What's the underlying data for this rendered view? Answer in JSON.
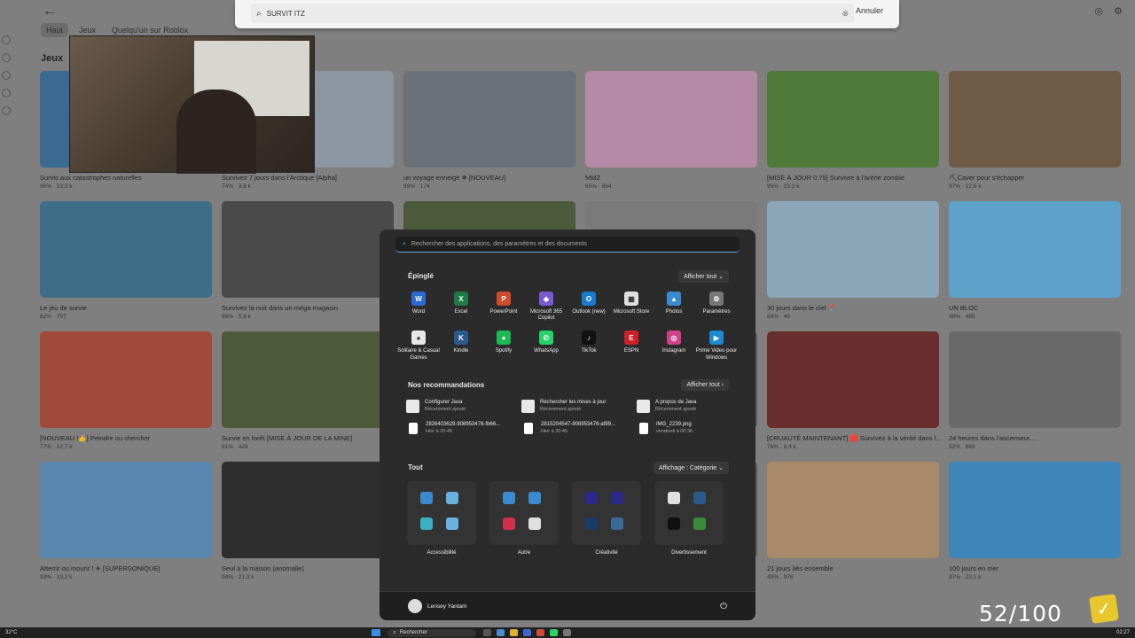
{
  "search": {
    "query": "SURVIT ITZ",
    "cancel_label": "Annuler"
  },
  "nav": {
    "tabs": [
      "Haut",
      "Jeux",
      "Quelqu'un sur Roblox"
    ],
    "section_title": "Jeux"
  },
  "games": [
    {
      "title": "Survis aux catastrophes naturelles",
      "stats": "90% · 13,3 k",
      "color": "#3a6a92"
    },
    {
      "title": "Survivez 7 jours dans l'Arctique [Alpha]",
      "stats": "74% · 3,8 k",
      "color": "#8c97a3"
    },
    {
      "title": "un voyage enneigé ❄ [NOUVEAU]",
      "stats": "89% · 174",
      "color": "#6a7278"
    },
    {
      "title": "MMZ",
      "stats": "65% · 864",
      "color": "#b58aa6"
    },
    {
      "title": "[MISE À JOUR 0.75] Survivre à l'arène zombie",
      "stats": "95% · 23,2 k",
      "color": "#4f7a3a"
    },
    {
      "title": "⛏Caver pour s'échapper",
      "stats": "97% · 12,6 k",
      "color": "#6e5a45"
    },
    {
      "title": "Le jeu de survie",
      "stats": "82% · 757",
      "color": "#3f6f88"
    },
    {
      "title": "Survivez la nuit dans un méga magasin",
      "stats": "95% · 5,8 k",
      "color": "#4a4a4a"
    },
    {
      "title": "",
      "stats": "",
      "color": "#4a5a3a"
    },
    {
      "title": "",
      "stats": "",
      "color": "#7a7a7a"
    },
    {
      "title": "30 jours dans le ciel 📍",
      "stats": "89% · 49",
      "color": "#8aa6b8"
    },
    {
      "title": "UN BLOC",
      "stats": "90% · 485",
      "color": "#5fa2c9"
    },
    {
      "title": "[NOUVEAU !👍] Peindre ou chercher",
      "stats": "77% · 12,7 k",
      "color": "#a24a3a"
    },
    {
      "title": "Survie en forêt [MISE À JOUR DE LA MINE]",
      "stats": "81% · 428",
      "color": "#4f5a3a"
    },
    {
      "title": "",
      "stats": "",
      "color": "#5a5a5a"
    },
    {
      "title": "",
      "stats": "",
      "color": "#5a5a5a"
    },
    {
      "title": "[CRUAUTÉ MAINTENANT] 🟥 Survivez à la vérité dans l...",
      "stats": "76% · 6,4 k",
      "color": "#6a2d2d"
    },
    {
      "title": "24 heures dans l'ascenseur...",
      "stats": "92% · 669",
      "color": "#6a6a6a"
    },
    {
      "title": "Atterrir ou mourir ! ✈ [SUPERSONIQUE]",
      "stats": "93% · 10,2 k",
      "color": "#5a87b0"
    },
    {
      "title": "Seul à la maison (anomalie)",
      "stats": "94% · 21,3 k",
      "color": "#2d2d2d"
    },
    {
      "title": "",
      "stats": "",
      "color": "#5a5a5a"
    },
    {
      "title": "",
      "stats": "",
      "color": "#5a5a5a"
    },
    {
      "title": "21 jours liés ensemble",
      "stats": "49% · 976",
      "color": "#a88a6a"
    },
    {
      "title": "100 jours en mer",
      "stats": "97% · 23,1 k",
      "color": "#3f86b8"
    }
  ],
  "start_menu": {
    "search_placeholder": "Rechercher des applications, des paramètres et des documents",
    "pinned_title": "Épinglé",
    "show_all": "Afficher tout",
    "pinned": [
      {
        "label": "Word",
        "glyph": "W",
        "color": "#2b6ad0"
      },
      {
        "label": "Excel",
        "glyph": "X",
        "color": "#1d7b45"
      },
      {
        "label": "PowerPoint",
        "glyph": "P",
        "color": "#d04a2b"
      },
      {
        "label": "Microsoft 365 Copilot",
        "glyph": "◆",
        "color": "#7a5ad0"
      },
      {
        "label": "Outlook (new)",
        "glyph": "O",
        "color": "#1a7ad0"
      },
      {
        "label": "Microsoft Store",
        "glyph": "▦",
        "color": "#e0e0e0"
      },
      {
        "label": "Photos",
        "glyph": "▲",
        "color": "#3a8ad0"
      },
      {
        "label": "Paramètres",
        "glyph": "⚙",
        "color": "#777"
      },
      {
        "label": "Solitaire & Casual Games",
        "glyph": "♠",
        "color": "#e8e8e8"
      },
      {
        "label": "Kindle",
        "glyph": "K",
        "color": "#2a5a8a"
      },
      {
        "label": "Spotify",
        "glyph": "●",
        "color": "#1db954"
      },
      {
        "label": "WhatsApp",
        "glyph": "✆",
        "color": "#25d366"
      },
      {
        "label": "TikTok",
        "glyph": "♪",
        "color": "#111"
      },
      {
        "label": "ESPN",
        "glyph": "E",
        "color": "#d0202a"
      },
      {
        "label": "Instagram",
        "glyph": "◎",
        "color": "#d0408a"
      },
      {
        "label": "Prime Video pour Windows",
        "glyph": "▶",
        "color": "#1a8ad0"
      }
    ],
    "recs_title": "Nos recommandations",
    "recs": [
      {
        "title": "Configurer Java",
        "sub": "Récemment ajouté",
        "kind": "app"
      },
      {
        "title": "Rechercher les mises à jour",
        "sub": "Récemment ajouté",
        "kind": "app"
      },
      {
        "title": "A propos de Java",
        "sub": "Récemment ajouté",
        "kind": "app"
      },
      {
        "title": "2826403629-908953476-fb66...",
        "sub": "Hier à 20:45",
        "kind": "doc"
      },
      {
        "title": "2815204547-908953476-af99...",
        "sub": "Hier à 20:45",
        "kind": "doc"
      },
      {
        "title": "IMG_2239.png",
        "sub": "vendredi à 00:36",
        "kind": "doc"
      }
    ],
    "all_title": "Tout",
    "view_label": "Affichage : Catégorie",
    "folders": [
      {
        "label": "Accessibilité",
        "colors": [
          "#3a8ad0",
          "#6ab0e0",
          "#3ab0c0",
          "#6ab0e0"
        ]
      },
      {
        "label": "Autre",
        "colors": [
          "#3a8ad0",
          "#3a8ad0",
          "#d0304a",
          "#e0e0e0"
        ]
      },
      {
        "label": "Créativité",
        "colors": [
          "#2a2a8a",
          "#2a2a8a",
          "#1a3a6a",
          "#3a6a9a"
        ]
      },
      {
        "label": "Divertissement",
        "colors": [
          "#e0e0e0",
          "#2a5a8a",
          "#111",
          "#3a8a3a"
        ]
      }
    ],
    "user_name": "Lensey Yantam"
  },
  "overlay": {
    "counter": "52/100"
  },
  "taskbar": {
    "weather": "32°C",
    "search_label": "Rechercher",
    "clock": "02:27"
  }
}
